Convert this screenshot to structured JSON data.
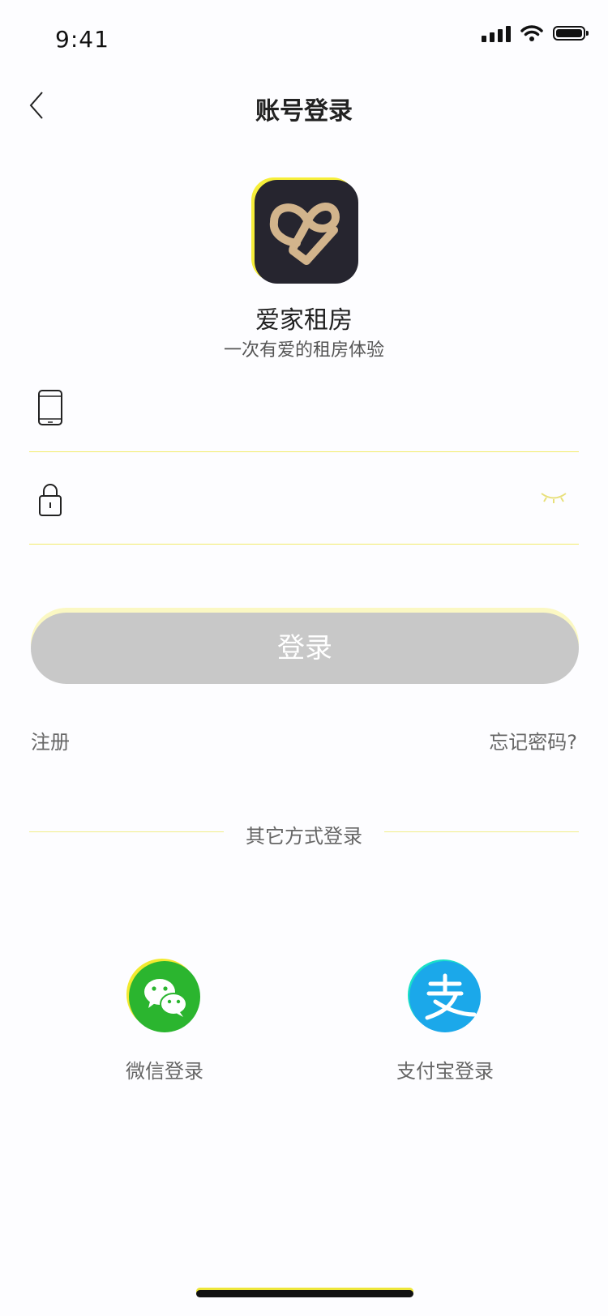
{
  "status_bar": {
    "time": "9:41"
  },
  "nav": {
    "title": "账号登录"
  },
  "app": {
    "name": "爱家租房",
    "slogan": "一次有爱的租房体验"
  },
  "form": {
    "phone": {
      "value": "",
      "placeholder": ""
    },
    "password": {
      "value": "",
      "placeholder": ""
    },
    "login_label": "登录"
  },
  "links": {
    "register": "注册",
    "forgot": "忘记密码?"
  },
  "divider": {
    "label": "其它方式登录"
  },
  "social": [
    {
      "label": "微信登录",
      "icon": "wechat-icon",
      "color": "#2bb52f"
    },
    {
      "label": "支付宝登录",
      "icon": "alipay-icon",
      "color": "#1ba8ea"
    }
  ],
  "colors": {
    "accent": "#f6ee3a",
    "button_disabled": "#c8c8c8",
    "logo_bg": "#26252f",
    "logo_mark": "#d2b48c"
  }
}
